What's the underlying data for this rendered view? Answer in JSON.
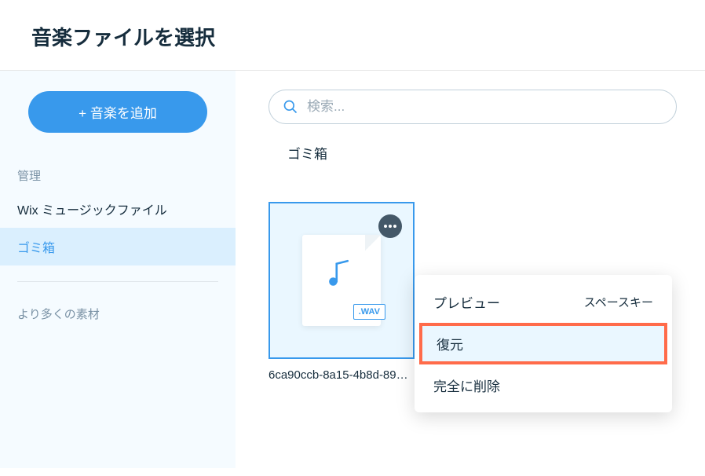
{
  "header": {
    "title": "音楽ファイルを選択"
  },
  "sidebar": {
    "add_label": "+ 音楽を追加",
    "section_manage": "管理",
    "items": [
      {
        "label": "Wix ミュージックファイル"
      },
      {
        "label": "ゴミ箱"
      }
    ],
    "section_more": "より多くの素材"
  },
  "search": {
    "placeholder": "検索..."
  },
  "breadcrumb": {
    "label": "ゴミ箱"
  },
  "file": {
    "ext": ".WAV",
    "name": "6ca90ccb-8a15-4b8d-89…"
  },
  "menu": {
    "preview": "プレビュー",
    "preview_hint": "スペースキー",
    "restore": "復元",
    "delete": "完全に削除"
  }
}
